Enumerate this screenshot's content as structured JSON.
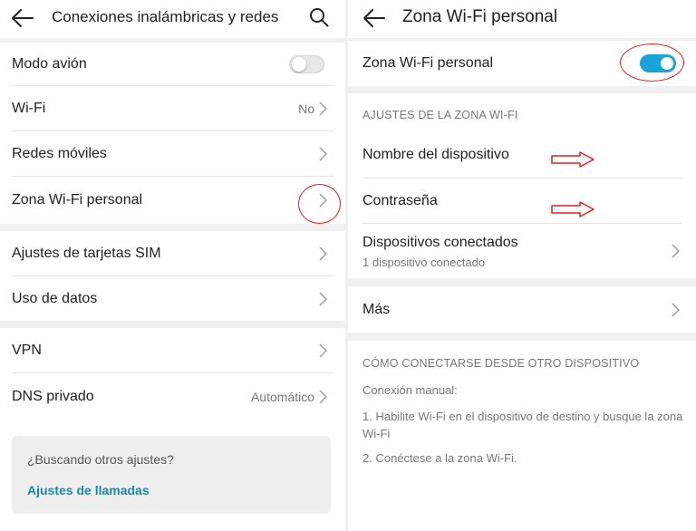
{
  "left": {
    "header": {
      "title": "Conexiones inalámbricas y redes",
      "back_icon": "arrow-left-icon",
      "search_icon": "search-icon"
    },
    "rows": [
      {
        "label": "Modo avión",
        "toggle": "off"
      },
      {
        "label": "Wi-Fi",
        "value": "No"
      },
      {
        "label": "Redes móviles"
      },
      {
        "label": "Zona Wi-Fi personal"
      },
      {
        "label": "Ajustes de tarjetas SIM"
      },
      {
        "label": "Uso de datos"
      },
      {
        "label": "VPN"
      },
      {
        "label": "DNS privado",
        "value": "Automático"
      }
    ],
    "card": {
      "question": "¿Buscando otros ajustes?",
      "link": "Ajustes de llamadas"
    }
  },
  "right": {
    "header": {
      "title": "Zona Wi-Fi personal",
      "back_icon": "arrow-left-icon"
    },
    "hotspot_row": {
      "label": "Zona Wi-Fi personal",
      "toggle": "on"
    },
    "section_header": "AJUSTES DE LA ZONA WI-FI",
    "rows": [
      {
        "label": "Nombre del dispositivo"
      },
      {
        "label": "Contraseña"
      },
      {
        "label": "Dispositivos conectados",
        "sub": "1 dispositivo conectado"
      }
    ],
    "more": {
      "label": "Más"
    },
    "info": {
      "header": "CÓMO CONECTARSE DESDE OTRO DISPOSITIVO",
      "manual": "Conexión manual:",
      "step1": "1. Habilite Wi-Fi en el dispositivo de destino y busque la zona Wi-Fi",
      "step2": "2. Conéctese a la zona Wi-Fi."
    }
  },
  "colors": {
    "accent": "#1aa3d9",
    "link": "#1a8aa8",
    "annotation": "#e02020",
    "separator": "#f0f0f0"
  }
}
